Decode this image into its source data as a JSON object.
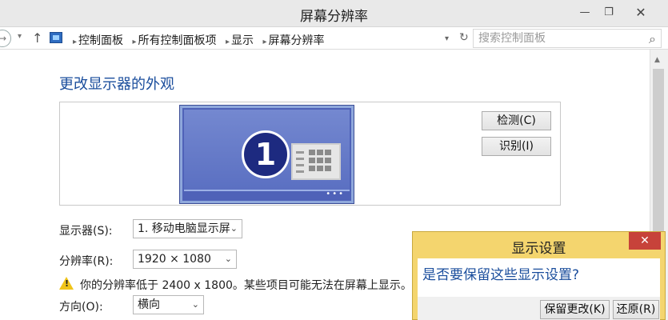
{
  "window": {
    "title": "屏幕分辨率",
    "min_glyph": "—",
    "max_glyph": "❐",
    "close_glyph": "✕"
  },
  "address": {
    "back_glyph": "→",
    "dropdown_glyph": "▾",
    "up_glyph": "↑",
    "breadcrumbs": [
      "控制面板",
      "所有控制面板项",
      "显示",
      "屏幕分辨率"
    ],
    "separator_glyph": "▸",
    "refresh_glyph": "↻",
    "search_placeholder": "搜索控制面板",
    "search_icon": "⌕"
  },
  "main": {
    "heading": "更改显示器的外观",
    "monitor_number": "1",
    "monitor_dots": "•••",
    "detect_label": "检测(C)",
    "identify_label": "识别(I)",
    "display_label": "显示器(S):",
    "display_value": "1. 移动电脑显示屏",
    "resolution_label": "分辨率(R):",
    "resolution_value": "1920 × 1080",
    "warning_text": "你的分辨率低于 2400 x 1800。某些项目可能无法在屏幕上显示。",
    "orientation_label": "方向(O):",
    "orientation_value": "横向",
    "chevron_glyph": "⌄"
  },
  "dialog": {
    "title": "显示设置",
    "close_glyph": "✕",
    "message": "是否要保留这些显示设置?",
    "keep_label": "保留更改(K)",
    "revert_label": "还原(R)"
  },
  "icons": {
    "warning": "warning-icon",
    "control_panel": "control-panel-icon",
    "search": "search-icon"
  }
}
